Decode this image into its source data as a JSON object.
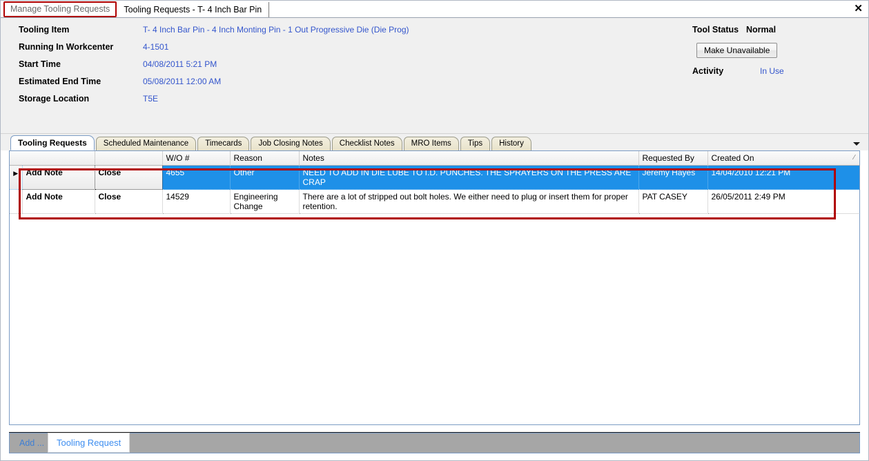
{
  "window": {
    "doc_tabs": [
      {
        "label": "Manage Tooling Requests",
        "active": false,
        "highlighted": true
      },
      {
        "label": "Tooling Requests - T- 4 Inch Bar Pin",
        "active": true,
        "highlighted": false
      }
    ],
    "close_icon": "✕"
  },
  "header": {
    "fields": [
      {
        "label": "Tooling Item",
        "value": "T- 4 Inch Bar Pin - 4 Inch Monting Pin - 1 Out Progressive Die (Die Prog)"
      },
      {
        "label": "Running In Workcenter",
        "value": "4-1501"
      },
      {
        "label": "Start Time",
        "value": "04/08/2011 5:21 PM"
      },
      {
        "label": "Estimated End Time",
        "value": "05/08/2011 12:00 AM"
      },
      {
        "label": "Storage Location",
        "value": "T5E"
      }
    ],
    "tool_status_label": "Tool Status",
    "tool_status_value": "Normal",
    "make_unavailable_label": "Make Unavailable",
    "activity_label": "Activity",
    "activity_value": "In Use"
  },
  "tabs": [
    {
      "label": "Tooling Requests",
      "active": true
    },
    {
      "label": "Scheduled Maintenance",
      "active": false
    },
    {
      "label": "Timecards",
      "active": false
    },
    {
      "label": "Job Closing Notes",
      "active": false
    },
    {
      "label": "Checklist Notes",
      "active": false
    },
    {
      "label": "MRO Items",
      "active": false
    },
    {
      "label": "Tips",
      "active": false
    },
    {
      "label": "History",
      "active": false
    }
  ],
  "grid": {
    "columns": [
      {
        "key": "gutter",
        "label": ""
      },
      {
        "key": "add_note",
        "label": ""
      },
      {
        "key": "close",
        "label": ""
      },
      {
        "key": "wo",
        "label": "W/O #"
      },
      {
        "key": "reason",
        "label": "Reason"
      },
      {
        "key": "notes",
        "label": "Notes"
      },
      {
        "key": "requested_by",
        "label": "Requested By"
      },
      {
        "key": "created_on",
        "label": "Created On"
      }
    ],
    "sort_indicator": "⁄",
    "rows": [
      {
        "selected": true,
        "indicator": "▶",
        "add_note": "Add Note",
        "close": "Close",
        "wo": "4655",
        "reason": "Other",
        "notes": "NEED TO ADD IN DIE LUBE TO I.D. PUNCHES. THE SPRAYERS ON THE PRESS ARE CRAP",
        "requested_by": "Jeremy Hayes",
        "created_on": "14/04/2010 12:21 PM"
      },
      {
        "selected": false,
        "indicator": "",
        "add_note": "Add Note",
        "close": "Close",
        "wo": "14529",
        "reason": "Engineering Change",
        "notes": "There are a lot of stripped out bolt holes. We either need to plug or insert them for proper retention.",
        "requested_by": "PAT CASEY",
        "created_on": "26/05/2011 2:49 PM"
      }
    ]
  },
  "footer": {
    "add_label": "Add ...",
    "popup_label": "Tooling Request"
  },
  "colors": {
    "selection_blue": "#1e90e8",
    "link_blue": "#3355cc",
    "annotation_red": "#b00000",
    "panel_gray": "#f0f0f0"
  }
}
